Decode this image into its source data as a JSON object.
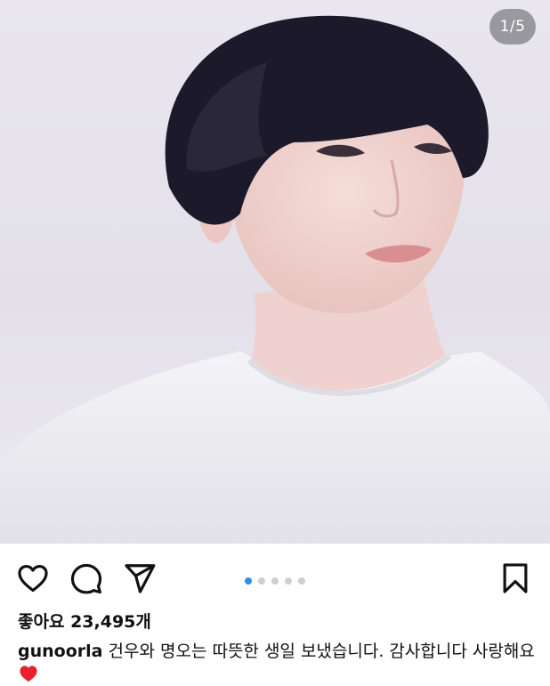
{
  "media": {
    "image_description_icon": "portrait-photo",
    "counter": "1/5",
    "slide_count": 5,
    "active_slide": 1
  },
  "actions": {
    "like_icon": "heart-outline-icon",
    "comment_icon": "comment-bubble-icon",
    "share_icon": "paper-plane-icon",
    "save_icon": "bookmark-outline-icon",
    "accent_color": "#2d8cf0"
  },
  "likes": {
    "label": "좋아요",
    "count": "23,495개"
  },
  "caption": {
    "username": "gunoorla",
    "text": "건우와 명오는 따뜻한 생일 보냈습니다. 감사합니다 사랑해요",
    "emoji_icon": "red-heart-emoji"
  }
}
